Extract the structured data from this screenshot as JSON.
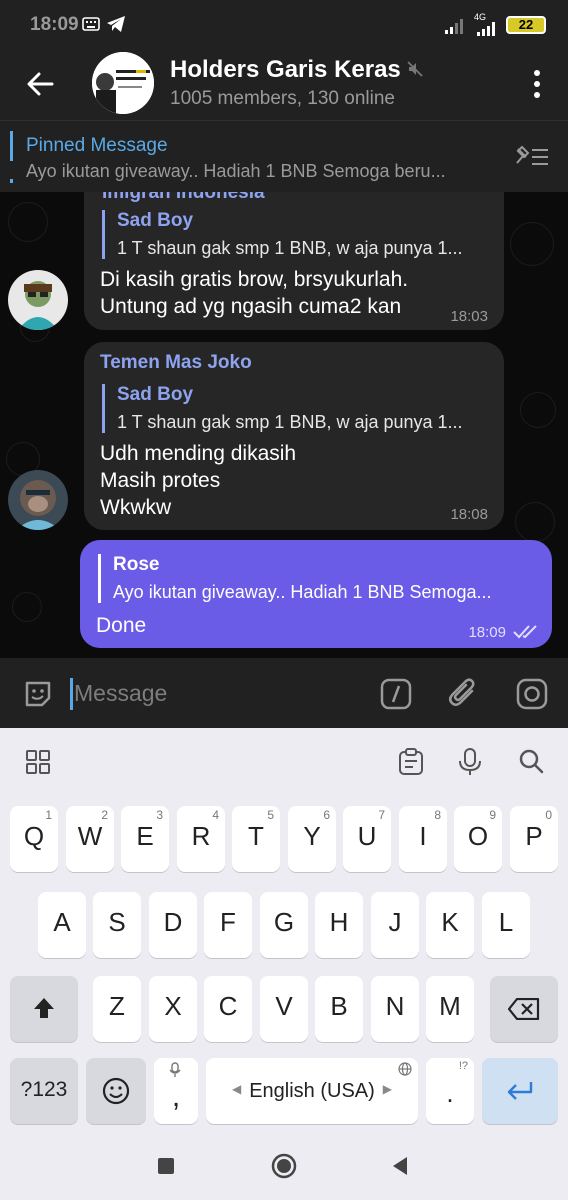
{
  "status": {
    "time": "18:09",
    "network": "4G",
    "battery": "22"
  },
  "header": {
    "title": "Holders Garis Keras",
    "subtitle": "1005 members, 130 online",
    "avatar_text": "\"IF YOU CAN'T HOLD YOU WON'T BE RICH\""
  },
  "pinned": {
    "title": "Pinned Message",
    "text": "Ayo ikutan giveaway..  Hadiah 1 BNB  Semoga beru..."
  },
  "messages": [
    {
      "sender": "Imigran Indonesia",
      "reply_name": "Sad Boy",
      "reply_text": "1 T shaun gak smp 1 BNB, w aja punya 1...",
      "lines": [
        "Di kasih gratis brow, brsyukurlah.",
        "Untung ad yg ngasih cuma2 kan"
      ],
      "time": "18:03"
    },
    {
      "sender": "Temen Mas Joko",
      "reply_name": "Sad Boy",
      "reply_text": "1 T shaun gak smp 1 BNB, w aja punya 1...",
      "lines": [
        "Udh mending dikasih",
        "Masih protes",
        "Wkwkw"
      ],
      "time": "18:08"
    },
    {
      "sender": "",
      "reply_name": "Rose",
      "reply_text": "Ayo ikutan giveaway..  Hadiah 1 BNB  Semoga...",
      "lines": [
        "Done"
      ],
      "time": "18:09"
    }
  ],
  "input": {
    "placeholder": "Message"
  },
  "keyboard": {
    "row1": [
      {
        "l": "Q",
        "n": "1"
      },
      {
        "l": "W",
        "n": "2"
      },
      {
        "l": "E",
        "n": "3"
      },
      {
        "l": "R",
        "n": "4"
      },
      {
        "l": "T",
        "n": "5"
      },
      {
        "l": "Y",
        "n": "6"
      },
      {
        "l": "U",
        "n": "7"
      },
      {
        "l": "I",
        "n": "8"
      },
      {
        "l": "O",
        "n": "9"
      },
      {
        "l": "P",
        "n": "0"
      }
    ],
    "row2": [
      "A",
      "S",
      "D",
      "F",
      "G",
      "H",
      "J",
      "K",
      "L"
    ],
    "row3": [
      "Z",
      "X",
      "C",
      "V",
      "B",
      "N",
      "M"
    ],
    "sym": "?123",
    "comma": ",",
    "space": "English (USA)",
    "period": ".",
    "period_hint": "!?"
  },
  "colors": {
    "accent": "#5aa9e6",
    "own_bubble": "#6a5ce7",
    "bubble": "#262626",
    "sender": "#8ea3f0"
  }
}
